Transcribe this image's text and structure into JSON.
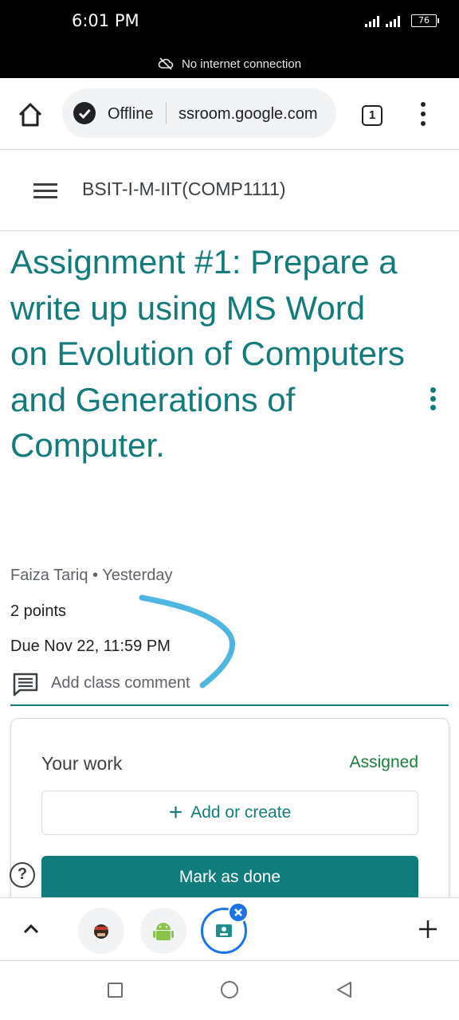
{
  "status_bar": {
    "time": "6:01 PM",
    "battery": "76",
    "network_notice": "No internet connection"
  },
  "browser": {
    "offline_label": "Offline",
    "url": "ssroom.google.com",
    "tab_count": "1"
  },
  "classroom": {
    "class_name": "BSIT-I-M-IIT(COMP1111)"
  },
  "assignment": {
    "title": "Assignment #1: Prepare a write up using MS Word on Evolution of Computers and Generations of Computer.",
    "author": "Faiza Tariq",
    "separator": "•",
    "posted": "Yesterday",
    "points": "2 points",
    "due": "Due Nov 22, 11:59 PM",
    "comment_placeholder": "Add class comment"
  },
  "your_work": {
    "title": "Your work",
    "status": "Assigned",
    "add_label": "Add or create",
    "done_label": "Mark as done"
  },
  "help": {
    "label": "?"
  },
  "colors": {
    "accent": "#137b7b",
    "button": "#107c7c",
    "assigned": "#188038",
    "tab_active": "#1a73e8",
    "scribble": "#4eb6e0"
  },
  "icons": [
    "cloud-off-icon",
    "home-icon",
    "offline-check-icon",
    "more-vert-icon",
    "hamburger-icon",
    "comment-icon",
    "help-icon",
    "chevron-up-icon",
    "close-icon",
    "plus-icon",
    "android-icon",
    "classroom-icon"
  ]
}
